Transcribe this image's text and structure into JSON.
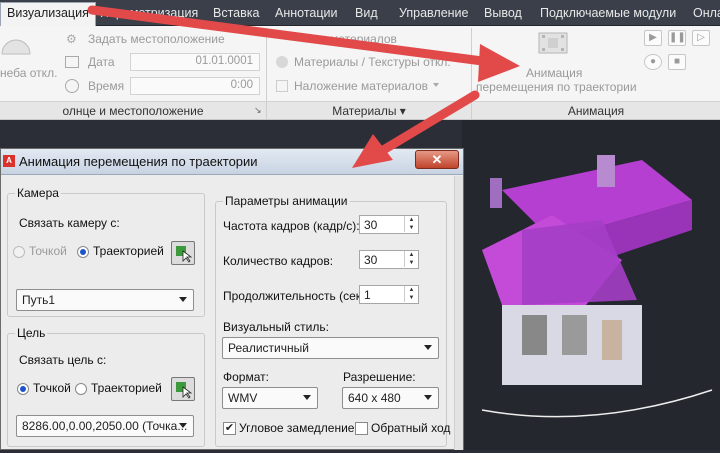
{
  "menu": [
    "Визуализация",
    "Параметризация",
    "Вставка",
    "Аннотации",
    "Вид",
    "Управление",
    "Вывод",
    "Подключаемые модули",
    "Онла"
  ],
  "ribbon": {
    "sun_label": "неба откл.",
    "set_location": "Задать местоположение",
    "date_label": "Дата",
    "date_value": "01.01.0001",
    "time_label": "Время",
    "time_value": "0:00",
    "materials_row1": "материалов",
    "materials_row2": "Материалы / Текстуры откл.",
    "materials_row3": "Наложение материалов",
    "animation_button_line1": "Анимация",
    "animation_button_line2": "перемещения по траектории",
    "panel_sun": "олнце и местоположение",
    "panel_materials": "Материалы",
    "panel_animation": "Анимация"
  },
  "dialog": {
    "title": "Анимация перемещения по траектории",
    "close": "✕",
    "camera_group": "Камера",
    "link_camera": "Связать камеру с:",
    "point": "Точкой",
    "path": "Траекторией",
    "camera_value": "Путь1",
    "target_group": "Цель",
    "link_target": "Связать цель с:",
    "target_value": "8286.00,0.00,2050.00  (Точка...",
    "anim_group": "Параметры анимации",
    "fps_label": "Частота кадров (кадр/с):",
    "fps_value": "30",
    "frames_label": "Количество кадров:",
    "frames_value": "30",
    "duration_label": "Продолжительность (сек.):",
    "duration_value": "1",
    "visual_style_label": "Визуальный стиль:",
    "visual_style_value": "Реалистичный",
    "format_label": "Формат:",
    "format_value": "WMV",
    "resolution_label": "Разрешение:",
    "resolution_value": "640 x 480",
    "corner_decel": "Угловое замедление",
    "reverse": "Обратный ход"
  },
  "colors": {
    "arrow": "#e24a4a",
    "roof": "#b43fd0",
    "accent": "#1c55c9"
  }
}
